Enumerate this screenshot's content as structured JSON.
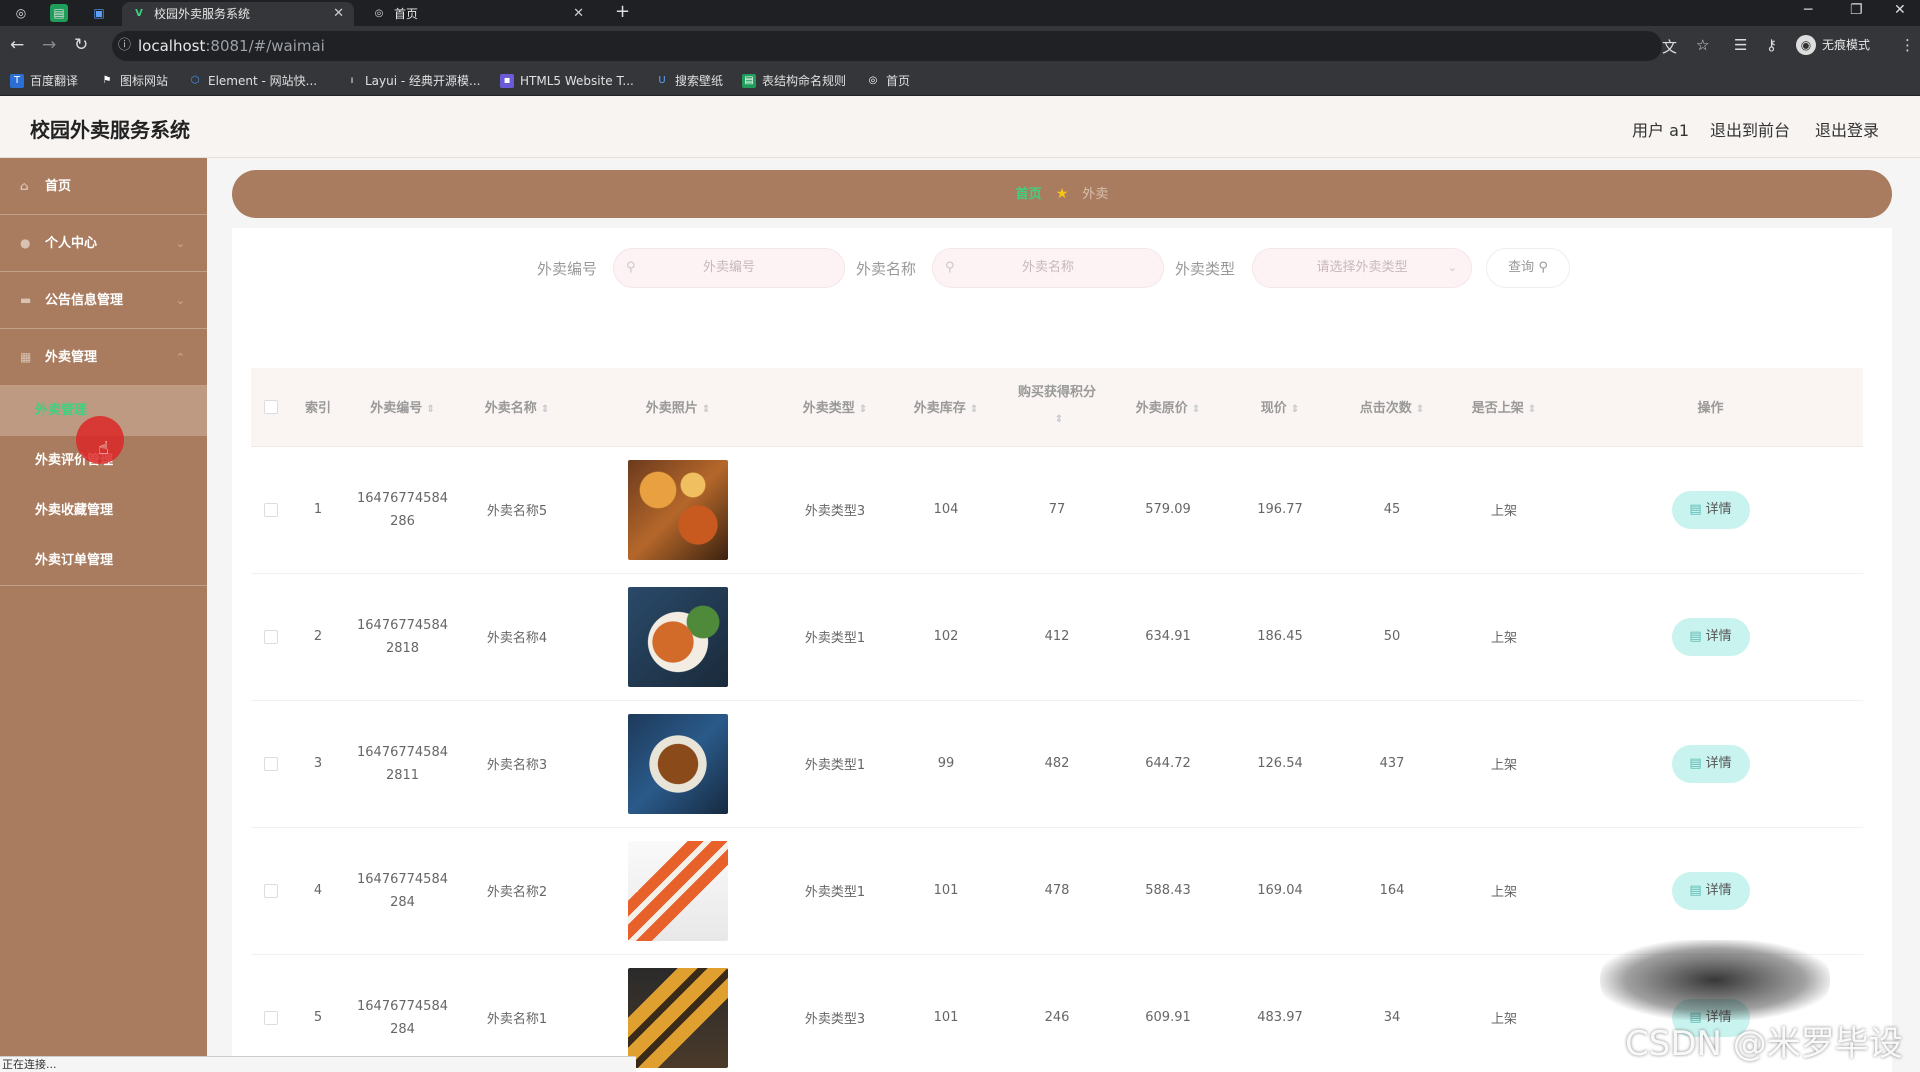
{
  "browser": {
    "tabs": [
      {
        "title": "校园外卖服务系统",
        "active": true
      },
      {
        "title": "首页",
        "active": false
      }
    ],
    "url_host": "localhost",
    "url_path": ":8081/#/waimai",
    "incognito_label": "无痕模式",
    "bookmarks": [
      "百度翻译",
      "图标网站",
      "Element - 网站快...",
      "Layui - 经典开源模...",
      "HTML5 Website T...",
      "搜索壁纸",
      "表结构命名规则",
      "首页"
    ]
  },
  "header": {
    "title": "校园外卖服务系统",
    "user_label": "用户 a1",
    "back_to_front": "退出到前台",
    "logout": "退出登录"
  },
  "sidebar": {
    "items": [
      {
        "label": "首页",
        "icon": "home-icon"
      },
      {
        "label": "个人中心",
        "icon": "user-icon"
      },
      {
        "label": "公告信息管理",
        "icon": "notice-icon"
      },
      {
        "label": "外卖管理",
        "icon": "grid-icon"
      }
    ],
    "submenu": [
      {
        "label": "外卖管理",
        "active": true
      },
      {
        "label": "外卖评价管理",
        "active": false
      },
      {
        "label": "外卖收藏管理",
        "active": false
      },
      {
        "label": "外卖订单管理",
        "active": false
      }
    ]
  },
  "status_text": "正在连接...",
  "breadcrumb": {
    "home": "首页",
    "current": "外卖"
  },
  "search": {
    "code_label": "外卖编号",
    "code_placeholder": "外卖编号",
    "name_label": "外卖名称",
    "name_placeholder": "外卖名称",
    "type_label": "外卖类型",
    "type_placeholder": "请选择外卖类型",
    "query_label": "查询"
  },
  "table": {
    "headers": [
      "索引",
      "外卖编号",
      "外卖名称",
      "外卖照片",
      "外卖类型",
      "外卖库存",
      "购买获得积分",
      "外卖原价",
      "现价",
      "点击次数",
      "是否上架",
      "操作"
    ],
    "detail_label": "详情",
    "rows": [
      {
        "index": "1",
        "code": "16476774584286",
        "name": "外卖名称5",
        "type": "外卖类型3",
        "stock": "104",
        "points": "77",
        "orig_price": "579.09",
        "price": "196.77",
        "clicks": "45",
        "status": "上架"
      },
      {
        "index": "2",
        "code": "164767745842818",
        "name": "外卖名称4",
        "type": "外卖类型1",
        "stock": "102",
        "points": "412",
        "orig_price": "634.91",
        "price": "186.45",
        "clicks": "50",
        "status": "上架"
      },
      {
        "index": "3",
        "code": "164767745842811",
        "name": "外卖名称3",
        "type": "外卖类型1",
        "stock": "99",
        "points": "482",
        "orig_price": "644.72",
        "price": "126.54",
        "clicks": "437",
        "status": "上架"
      },
      {
        "index": "4",
        "code": "16476774584284",
        "name": "外卖名称2",
        "type": "外卖类型1",
        "stock": "101",
        "points": "478",
        "orig_price": "588.43",
        "price": "169.04",
        "clicks": "164",
        "status": "上架"
      },
      {
        "index": "5",
        "code": "16476774584284",
        "name": "外卖名称1",
        "type": "外卖类型3",
        "stock": "101",
        "points": "246",
        "orig_price": "609.91",
        "price": "483.97",
        "clicks": "34",
        "status": "上架"
      }
    ]
  },
  "watermark": "CSDN @米罗毕设",
  "colors": {
    "sidebar": "#a97c5f",
    "accent_green": "#3fd080",
    "detail_button": "#c9f3ef"
  }
}
